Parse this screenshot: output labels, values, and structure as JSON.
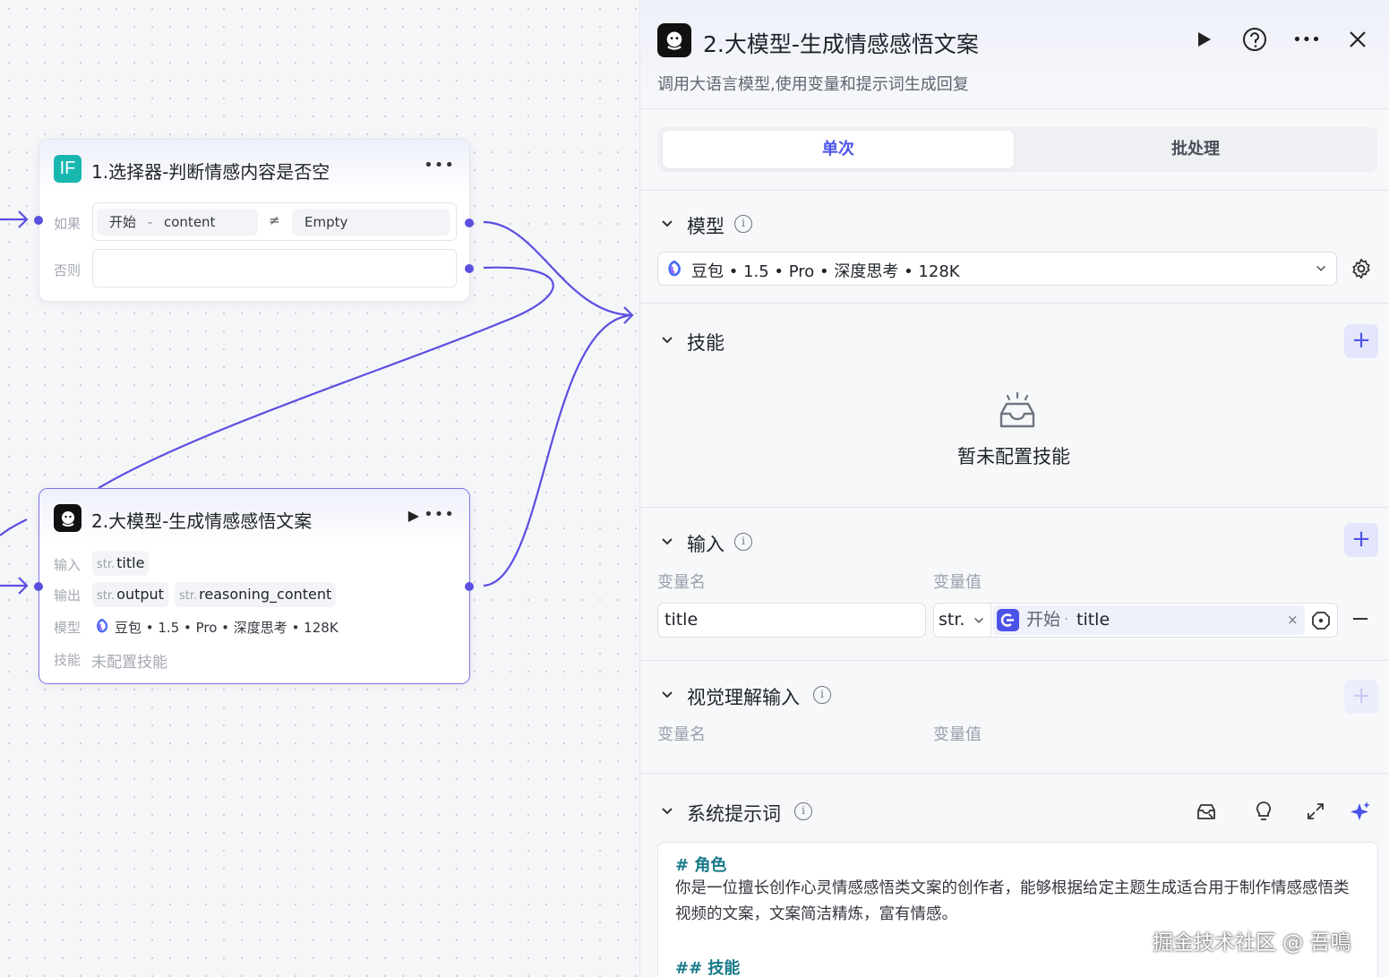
{
  "canvas": {
    "selector_node": {
      "title": "1.选择器-判断情感内容是否空",
      "icon": "IF",
      "if_label": "如果",
      "else_label": "否则",
      "condition": {
        "left": "开始",
        "sep": "-",
        "field": "content",
        "operator": "≠",
        "value": "Empty"
      }
    },
    "llm_node": {
      "title": "2.大模型-生成情感感悟文案",
      "input_label": "输入",
      "output_label": "输出",
      "model_label": "模型",
      "skill_label": "技能",
      "inputs": [
        {
          "type": "str.",
          "name": "title"
        }
      ],
      "outputs": [
        {
          "type": "str.",
          "name": "output"
        },
        {
          "type": "str.",
          "name": "reasoning_content"
        }
      ],
      "model": "豆包 • 1.5 • Pro • 深度思考 • 128K",
      "skill_value": "未配置技能"
    }
  },
  "panel": {
    "title": "2.大模型-生成情感感悟文案",
    "description": "调用大语言模型,使用变量和提示词生成回复",
    "tabs": {
      "single": "单次",
      "batch": "批处理"
    },
    "model_section": {
      "title": "模型",
      "selected": "豆包 • 1.5 • Pro • 深度思考 • 128K"
    },
    "skills_section": {
      "title": "技能",
      "empty_text": "暂未配置技能"
    },
    "input_section": {
      "title": "输入",
      "col_name": "变量名",
      "col_value": "变量值",
      "rows": [
        {
          "name": "title",
          "type": "str.",
          "source": "开始",
          "dot": "·",
          "field": "title"
        }
      ]
    },
    "vision_section": {
      "title": "视觉理解输入",
      "col_name": "变量名",
      "col_value": "变量值"
    },
    "system_prompt_section": {
      "title": "系统提示词",
      "h1": "# 角色",
      "p1": "你是一位擅长创作心灵情感感悟类文案的创作者，能够根据给定主题生成适合用于制作情感感悟类视频的文案，文案简洁精炼，富有情感。",
      "h2": "## 技能"
    }
  },
  "watermark": "掘金技术社区 @ 吾鳴",
  "colors": {
    "accent": "#4d53e8",
    "edge": "#5b4fe0",
    "if_icon": "#17b7b0"
  }
}
